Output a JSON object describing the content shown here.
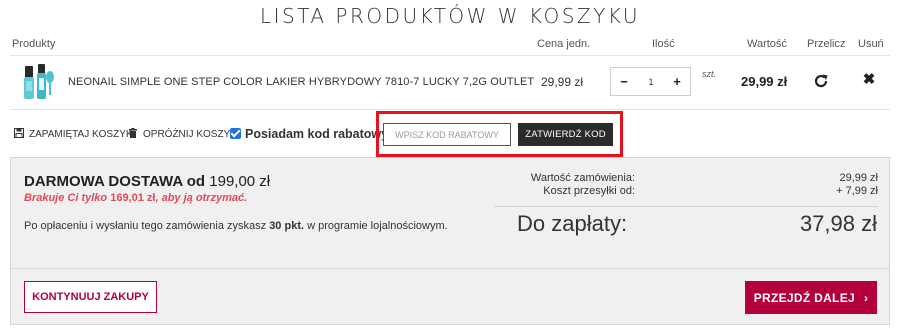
{
  "page_title": "LISTA PRODUKTÓW W KOSZYKU",
  "table": {
    "headers": {
      "product": "Produkty",
      "unit_price": "Cena jedn.",
      "quantity": "Ilość",
      "value": "Wartość",
      "recalculate": "Przelicz",
      "remove": "Usuń"
    },
    "items": [
      {
        "name": "NEONAIL SIMPLE ONE STEP COLOR LAKIER HYBRYDOWY 7810-7 LUCKY 7,2G OUTLET",
        "unit_price": "29,99 zł",
        "qty_minus": "−",
        "qty_value": "1",
        "qty_plus": "+",
        "unit": "szt.",
        "value": "29,99 zł",
        "thumbnail_icon": "product-bottle-icon",
        "recalc_icon": "refresh-icon",
        "remove_icon": "close-icon"
      }
    ]
  },
  "actions": {
    "save_cart": "ZAPAMIĘTAJ KOSZYK",
    "empty_cart": "OPRÓŻNIJ KOSZYK",
    "has_coupon_label": "Posiadam kod rabatowy",
    "has_coupon_checked": true,
    "coupon_placeholder": "WPISZ KOD RABATOWY",
    "confirm_code": "ZATWIERDŹ KOD"
  },
  "summary": {
    "free_shipping_label": "DARMOWA DOSTAWA od",
    "free_shipping_amount": "199,00 zł",
    "missing_prefix": "Brakuje Ci tylko",
    "missing_amount": "169,01 zł",
    "missing_suffix": ", aby ją otrzymać.",
    "loyalty_prefix": "Po opłaceniu i wysłaniu tego zamówienia zyskasz",
    "loyalty_points": "30 pkt.",
    "loyalty_suffix": "w programie lojalnościowym.",
    "order_value_label": "Wartość zamówienia:",
    "order_value": "29,99 zł",
    "shipping_label": "Koszt przesyłki od:",
    "shipping_value": "+ 7,99 zł",
    "total_label": "Do zapłaty:",
    "total_value": "37,98 zł"
  },
  "buttons": {
    "continue": "KONTYNUUJ ZAKUPY",
    "next": "PRZEJDŹ DALEJ",
    "next_arrow": "›"
  },
  "colors": {
    "brand": "#b3003d",
    "highlight": "#e5131d",
    "warning_text": "#e04a5a",
    "summary_bg": "#f0f0f0"
  }
}
